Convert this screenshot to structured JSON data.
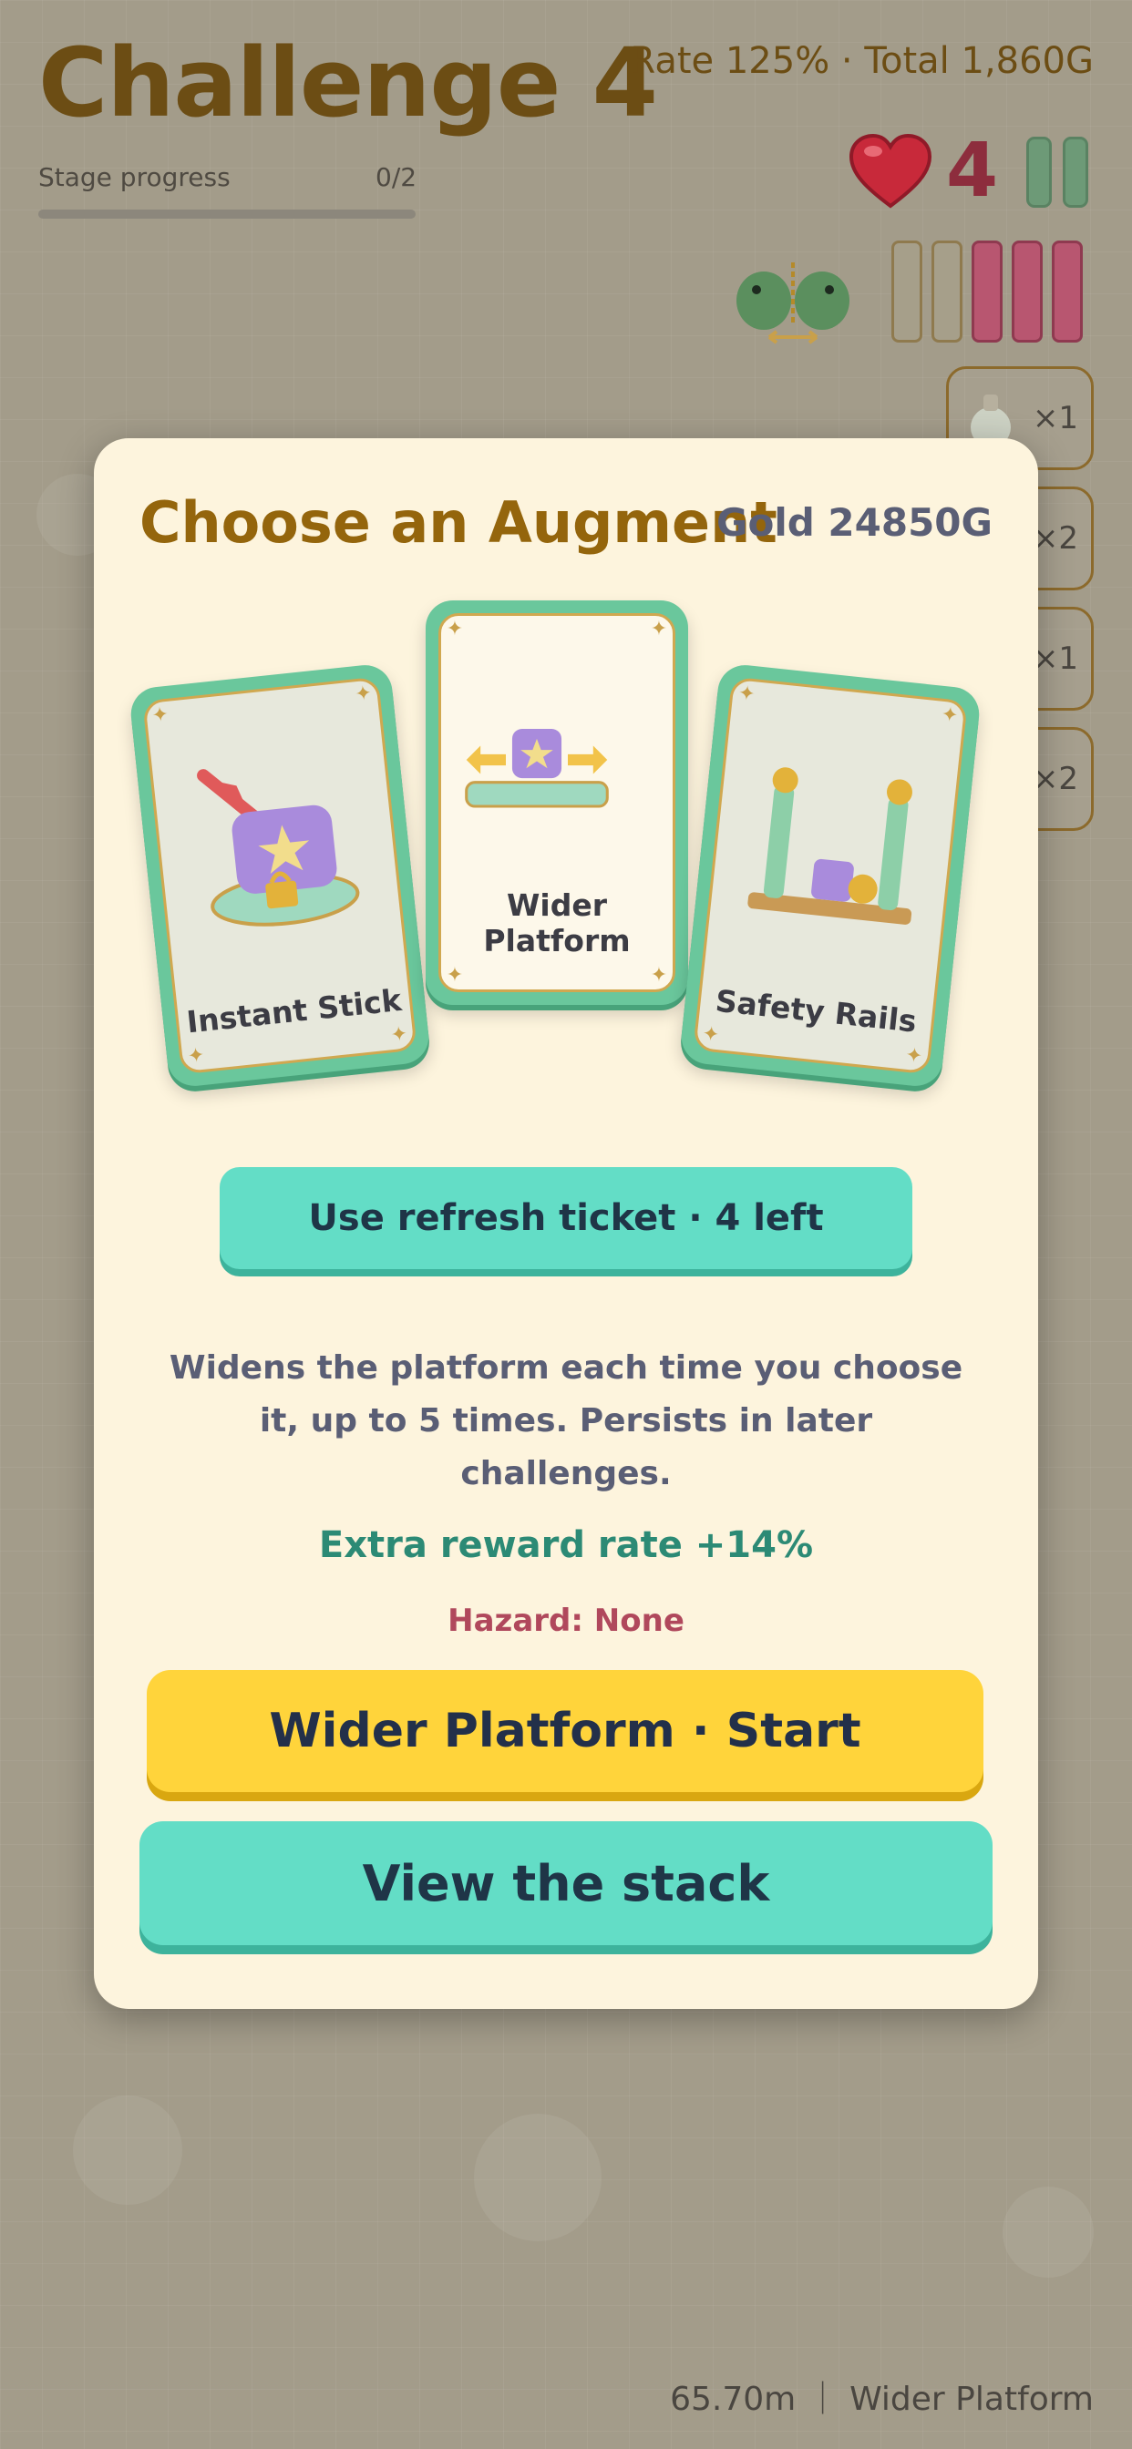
{
  "hud": {
    "title": "Challenge 4",
    "progress_label": "Stage progress",
    "progress_count": "0/2",
    "progress_fraction": 0,
    "stats": "Rate 125% · Total 1,860G",
    "lives": "4",
    "lives_icon": "heart-icon",
    "meter_segments": [
      "empty",
      "empty",
      "filled",
      "filled",
      "filled"
    ],
    "inventory": [
      {
        "icon": "potion-icon",
        "count": "×1"
      },
      {
        "icon": "item-icon",
        "count": "×2"
      },
      {
        "icon": "item-icon",
        "count": "×1"
      },
      {
        "icon": "item-icon",
        "count": "×2"
      }
    ]
  },
  "modal": {
    "title": "Choose an Augment",
    "gold": "Gold 24850G",
    "cards": [
      {
        "label": "Instant Stick",
        "art": "locked-block-icon",
        "selected": false
      },
      {
        "label": "Wider Platform",
        "art": "wide-platform-icon",
        "selected": true
      },
      {
        "label": "Safety Rails",
        "art": "rails-icon",
        "selected": false
      }
    ],
    "refresh_label": "Use refresh ticket · 4 left",
    "description": "Widens the platform each time you choose it, up to 5 times. Persists in later challenges.",
    "reward": "Extra reward rate +14%",
    "hazard": "Hazard: None",
    "primary_label": "Wider Platform · Start",
    "secondary_label": "View the stack"
  },
  "footer": {
    "status": "65.70m ｜ Wider Platform"
  },
  "colors": {
    "accent_gold": "#94650c",
    "button_yellow": "#ffd43b",
    "button_teal": "#63ddc6",
    "card_green": "#6ac79c",
    "reward_green": "#2c8a75",
    "hazard_red": "#b0485c"
  }
}
